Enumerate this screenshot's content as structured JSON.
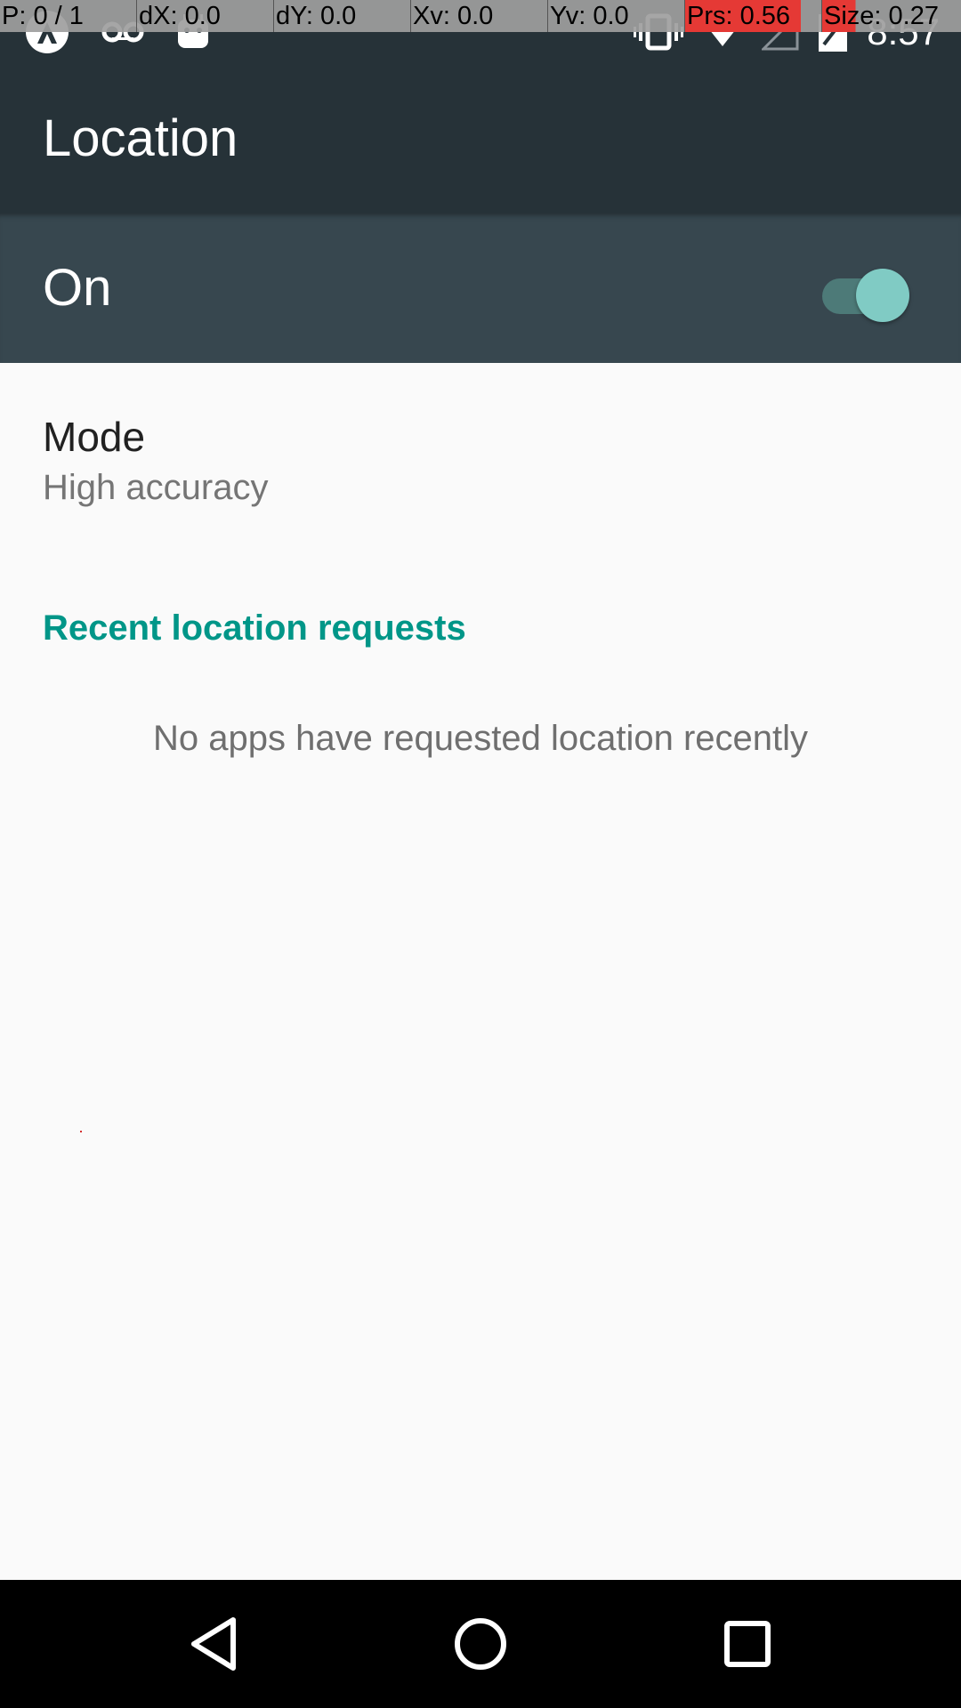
{
  "debug_overlay": {
    "pointer": "P: 0 / 1",
    "dx": "dX: 0.0",
    "dy": "dY: 0.0",
    "xv": "Xv: 0.0",
    "yv": "Yv: 0.0",
    "prs": "Prs: 0.56",
    "size": "Size: 0.27"
  },
  "status_bar": {
    "time": "8:57",
    "left_icons": [
      "app-notification-icon",
      "voicemail-icon",
      "android-icon"
    ],
    "right_icons": [
      "vibrate-icon",
      "wifi-icon",
      "cell-signal-icon",
      "battery-icon"
    ]
  },
  "toolbar": {
    "title": "Location"
  },
  "master_switch": {
    "label": "On",
    "checked": true
  },
  "mode": {
    "title": "Mode",
    "summary": "High accuracy"
  },
  "recent_requests": {
    "header": "Recent location requests",
    "empty_text": "No apps have requested location recently"
  },
  "nav_bar": {
    "buttons": [
      "back",
      "home",
      "recents"
    ]
  },
  "colors": {
    "toolbar": "#263238",
    "switch_bar": "#37474f",
    "accent": "#009688",
    "switch_thumb": "#80cbc4"
  }
}
